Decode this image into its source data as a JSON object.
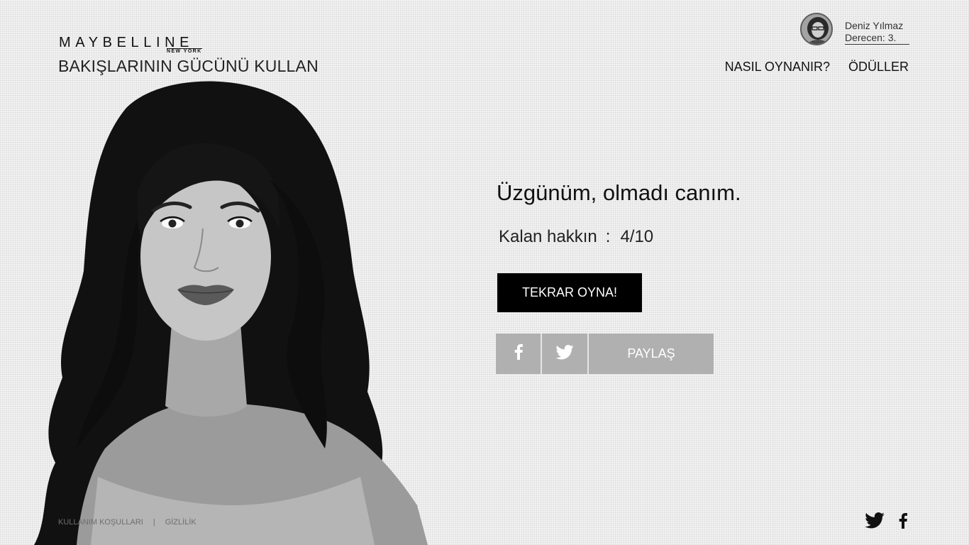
{
  "brand": {
    "logo_word": "MAYBELLINE",
    "logo_sub": "NEW YORK",
    "tagline": "BAKIŞLARININ GÜCÜNÜ KULLAN"
  },
  "user": {
    "name": "Deniz Yılmaz",
    "rank": "Derecen: 3."
  },
  "nav": {
    "how_to_play": "NASIL OYNANIR?",
    "prizes": "ÖDÜLLER"
  },
  "result": {
    "title": "Üzgünüm, olmadı canım.",
    "remaining_label": "Kalan hakkın",
    "remaining_colon": ":",
    "remaining_value": "4/10"
  },
  "actions": {
    "replay": "TEKRAR OYNA!",
    "share": "PAYLAŞ"
  },
  "icons": {
    "facebook": "facebook-icon",
    "twitter": "twitter-icon"
  },
  "footer": {
    "terms": "KULLANIM KOŞULLARI",
    "separator": "|",
    "privacy": "GİZLİLİK"
  },
  "colors": {
    "button_bg": "#000000",
    "share_bg": "#b0b0b0"
  }
}
